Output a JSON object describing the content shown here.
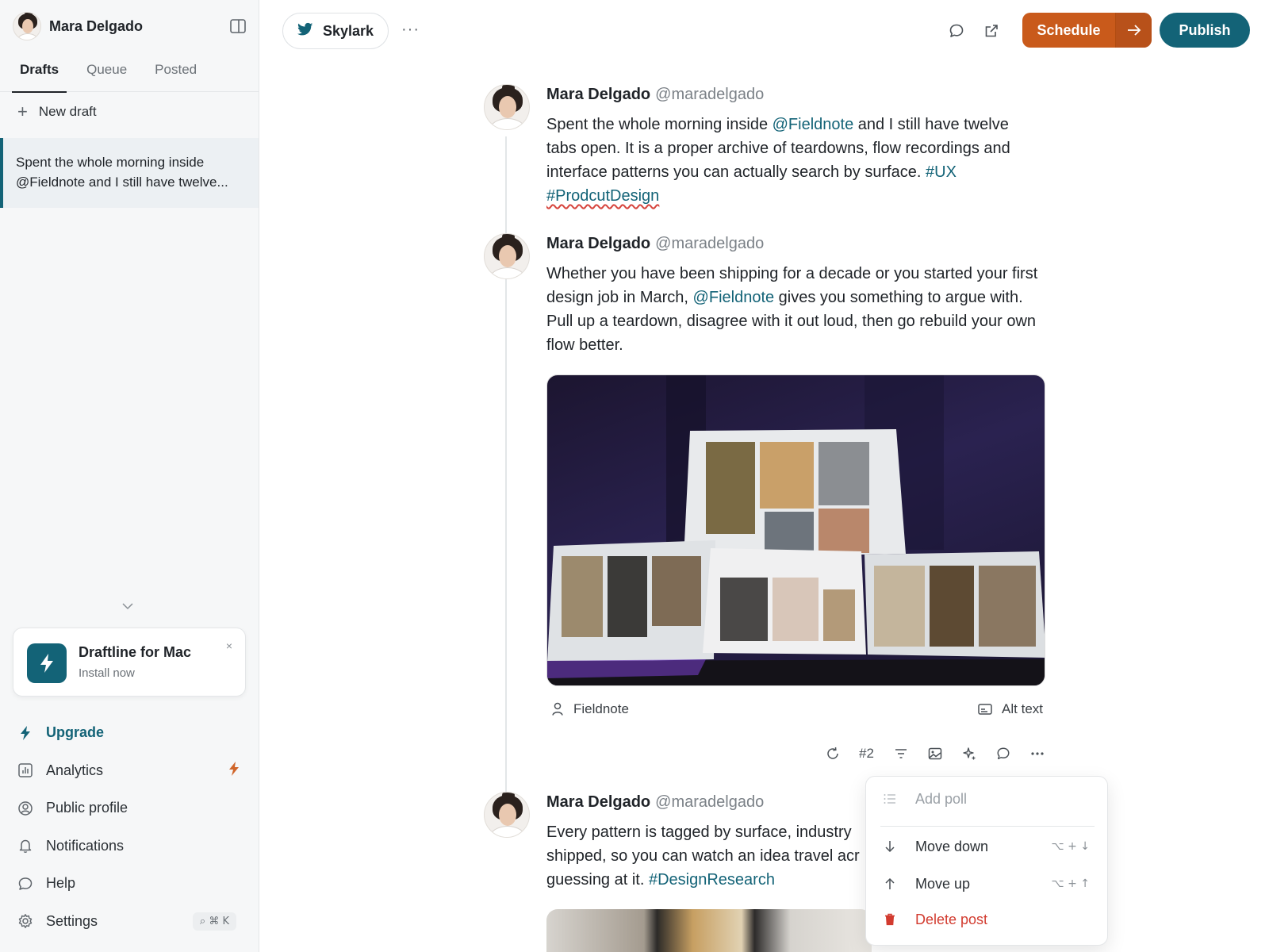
{
  "sidebar": {
    "user_name": "Mara Delgado",
    "tabs": [
      {
        "label": "Drafts",
        "active": true
      },
      {
        "label": "Queue",
        "active": false
      },
      {
        "label": "Posted",
        "active": false
      }
    ],
    "new_draft_label": "New draft",
    "drafts": [
      {
        "preview": "Spent the whole morning inside @Fieldnote and I still have twelve..."
      }
    ],
    "promo": {
      "title": "Draftline for Mac",
      "subtitle": "Install now",
      "close": "×"
    },
    "nav": {
      "upgrade": "Upgrade",
      "analytics": "Analytics",
      "public_profile": "Public profile",
      "notifications": "Notifications",
      "help": "Help",
      "settings": "Settings",
      "shortcut": "⌕ ⌘ K"
    }
  },
  "topbar": {
    "account_name": "Skylark",
    "more": "···",
    "schedule_label": "Schedule",
    "publish_label": "Publish"
  },
  "thread": {
    "author_name": "Mara Delgado",
    "author_handle": "@maradelgado",
    "posts": [
      {
        "t1": "Spent the whole morning inside ",
        "m1": "@Fieldnote",
        "t2": " and I still have twelve tabs open. It is a proper archive of teardowns, flow recordings and interface patterns you can actually search by surface. ",
        "h1": "#UX",
        "h2": "#ProdcutDesign"
      },
      {
        "t1": "Whether you have been shipping for a decade or you started your first design job in March, ",
        "m1": "@Fieldnote",
        "t2": " gives you something to argue with. Pull up a teardown, disagree with it out loud, then go rebuild your own flow better.",
        "media_tag": "Fieldnote",
        "alt_text": "Alt text",
        "number": "#2"
      },
      {
        "t1": "Every pattern is tagged by surface, industry",
        "t2": "shipped, so you can watch an idea travel acr",
        "t3": "guessing at it. ",
        "h1": "#DesignResearch"
      }
    ]
  },
  "context_menu": {
    "add_poll": "Add poll",
    "move_down": "Move down",
    "move_down_shortcut": "⌥ + ↓",
    "move_up": "Move up",
    "move_up_shortcut": "⌥ + ↑",
    "delete_post": "Delete post"
  },
  "colors": {
    "accent": "#136377",
    "schedule": "#c95a1b",
    "danger": "#d23b2f",
    "sidebar_bg": "#f6f7f8"
  }
}
